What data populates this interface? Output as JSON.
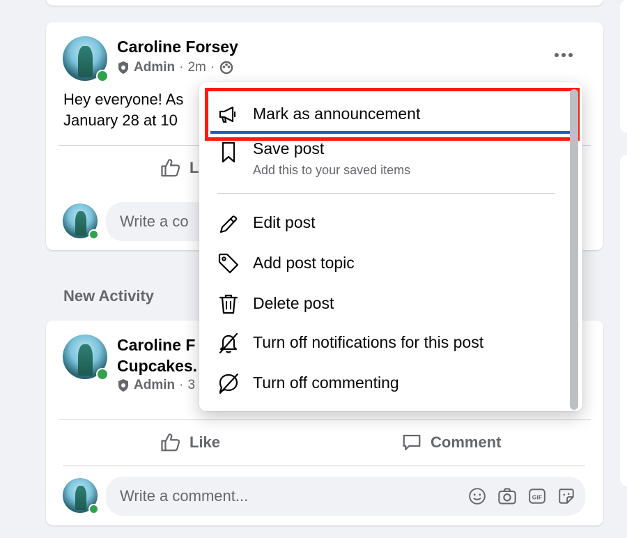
{
  "post1": {
    "author": "Caroline Forsey",
    "role": "Admin",
    "time": "2m",
    "text_line1": "Hey everyone! As",
    "text_line2": "January 28 at 10",
    "like_label": "L",
    "comment_placeholder": "Write a co"
  },
  "section": {
    "title": "New Activity"
  },
  "post2": {
    "author_line1": "Caroline F",
    "author_line2": "Cupcakes.",
    "role": "Admin",
    "time_partial": "3",
    "like_label": "Like",
    "comment_label": "Comment",
    "comment_placeholder": "Write a comment..."
  },
  "menu": {
    "items": [
      {
        "label": "Mark as announcement",
        "icon": "megaphone-icon"
      },
      {
        "label": "Save post",
        "sub": "Add this to your saved items",
        "icon": "bookmark-icon"
      },
      {
        "label": "Edit post",
        "icon": "pencil-icon"
      },
      {
        "label": "Add post topic",
        "icon": "tag-icon"
      },
      {
        "label": "Delete post",
        "icon": "trash-icon"
      },
      {
        "label": "Turn off notifications for this post",
        "icon": "bell-off-icon"
      },
      {
        "label": "Turn off commenting",
        "icon": "comment-off-icon"
      }
    ]
  },
  "colors": {
    "highlight": "#ff1a0a",
    "online": "#31a24c",
    "focus": "#1f5fbf"
  }
}
